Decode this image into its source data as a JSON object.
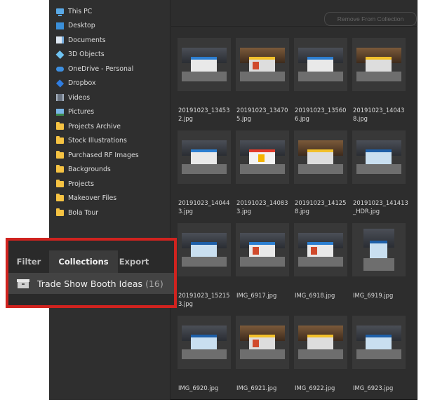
{
  "folders": [
    {
      "label": "This PC",
      "icon": "pc-icon"
    },
    {
      "label": "Desktop",
      "icon": "desktop-icon"
    },
    {
      "label": "Documents",
      "icon": "documents-icon"
    },
    {
      "label": "3D Objects",
      "icon": "3d-objects-icon"
    },
    {
      "label": "OneDrive - Personal",
      "icon": "onedrive-icon"
    },
    {
      "label": "Dropbox",
      "icon": "dropbox-icon"
    },
    {
      "label": "Videos",
      "icon": "videos-icon"
    },
    {
      "label": "Pictures",
      "icon": "pictures-icon"
    },
    {
      "label": "Projects Archive",
      "icon": "folder-icon"
    },
    {
      "label": "Stock Illustrations",
      "icon": "folder-icon"
    },
    {
      "label": "Purchased RF Images",
      "icon": "folder-icon"
    },
    {
      "label": "Backgrounds",
      "icon": "folder-icon"
    },
    {
      "label": "Projects",
      "icon": "folder-icon"
    },
    {
      "label": "Makeover Files",
      "icon": "folder-icon"
    },
    {
      "label": "Bola Tour",
      "icon": "folder-icon"
    }
  ],
  "toolbar": {
    "remove_label": "Remove From Collection"
  },
  "images": [
    {
      "name": "20191023_134532.jpg"
    },
    {
      "name": "20191023_134705.jpg"
    },
    {
      "name": "20191023_135606.jpg"
    },
    {
      "name": "20191023_140438.jpg"
    },
    {
      "name": "20191023_140443.jpg"
    },
    {
      "name": "20191023_140833.jpg"
    },
    {
      "name": "20191023_141258.jpg"
    },
    {
      "name": "20191023_141413_HDR.jpg"
    },
    {
      "name": "20191023_152153.jpg"
    },
    {
      "name": "IMG_6917.jpg"
    },
    {
      "name": "IMG_6918.jpg"
    },
    {
      "name": "IMG_6919.jpg"
    },
    {
      "name": "IMG_6920.jpg"
    },
    {
      "name": "IMG_6921.jpg"
    },
    {
      "name": "IMG_6922.jpg"
    },
    {
      "name": "IMG_6923.jpg"
    }
  ],
  "panel": {
    "tabs": [
      {
        "label": "Filter"
      },
      {
        "label": "Collections"
      },
      {
        "label": "Export"
      }
    ],
    "active_tab": "Collections",
    "collection": {
      "name": "Trade Show Booth Ideas",
      "count": "(16)"
    }
  },
  "colors": {
    "highlight_border": "#d0231f",
    "background": "#2d2d2d"
  }
}
